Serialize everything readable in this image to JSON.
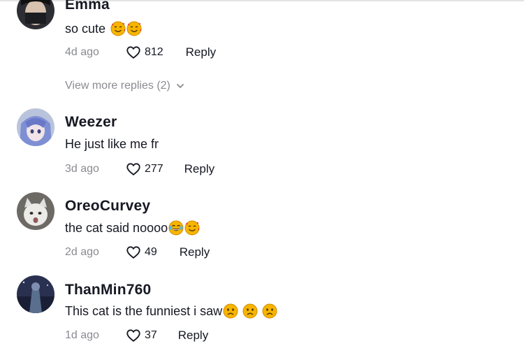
{
  "comments": [
    {
      "username": "Emma",
      "text": "so cute",
      "emojis": [
        "smiling-face-with-hearts",
        "smiling-face-with-hearts"
      ],
      "time": "4d ago",
      "likes": "812",
      "reply_label": "Reply",
      "avatar": "dark-haired-person-avatar"
    },
    {
      "username": "Weezer",
      "text": "He just like me fr",
      "emojis": [],
      "time": "3d ago",
      "likes": "277",
      "reply_label": "Reply",
      "avatar": "anime-blue-hair-avatar"
    },
    {
      "username": "OreoCurvey",
      "text": "the cat said noooo",
      "emojis": [
        "face-with-tears-of-joy",
        "smiling-face-with-hearts"
      ],
      "time": "2d ago",
      "likes": "49",
      "reply_label": "Reply",
      "avatar": "white-cat-avatar"
    },
    {
      "username": "ThanMin760",
      "text": "This cat is the funniest i saw",
      "emojis": [
        "frowning-face",
        "frowning-face",
        "frowning-face"
      ],
      "time": "1d ago",
      "likes": "37",
      "reply_label": "Reply",
      "avatar": "dark-scene-avatar"
    }
  ],
  "view_more": {
    "label": "View more replies (2)"
  },
  "colors": {
    "text_primary": "#161823",
    "text_secondary": "#8a8b91",
    "emoji_yellow": "#f7b500",
    "emoji_heart": "#e8334a"
  }
}
